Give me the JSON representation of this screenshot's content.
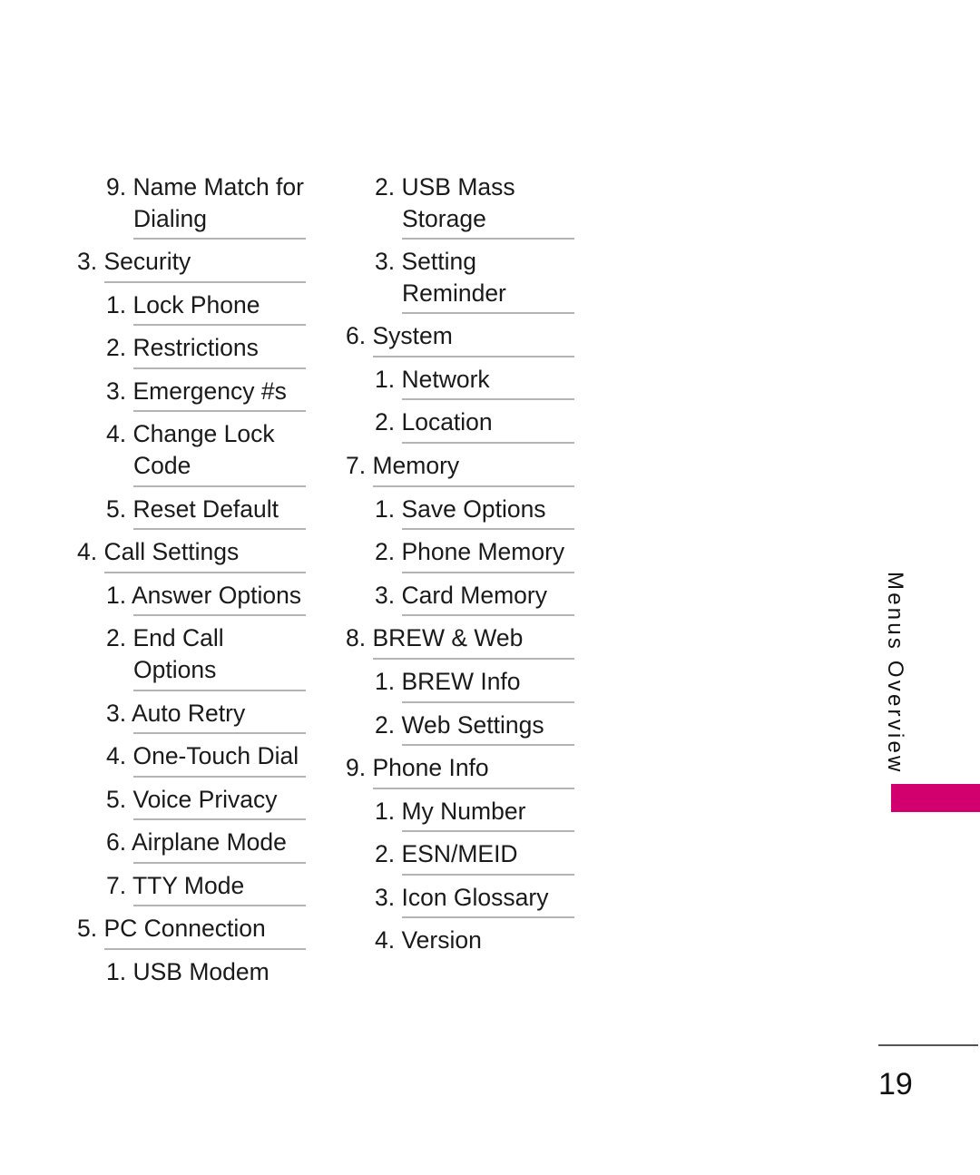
{
  "page": {
    "number": "19",
    "section_label": "Menus Overview",
    "accent_color": "#d2006e",
    "rule_color": "#b4b4b4",
    "text_color": "#1a1a1a"
  },
  "columns": [
    {
      "id": "left",
      "items": [
        {
          "label": "9. Name Match for Dialing",
          "level": 2
        },
        {
          "label": "3. Security",
          "level": 1
        },
        {
          "label": "1. Lock Phone",
          "level": 2
        },
        {
          "label": "2. Restrictions",
          "level": 2
        },
        {
          "label": "3. Emergency #s",
          "level": 2
        },
        {
          "label": "4. Change Lock Code",
          "level": 2
        },
        {
          "label": "5. Reset Default",
          "level": 2
        },
        {
          "label": "4. Call Settings",
          "level": 1
        },
        {
          "label": "1. Answer Options",
          "level": 2
        },
        {
          "label": "2. End Call Options",
          "level": 2
        },
        {
          "label": "3. Auto Retry",
          "level": 2
        },
        {
          "label": "4. One-Touch Dial",
          "level": 2
        },
        {
          "label": "5. Voice Privacy",
          "level": 2
        },
        {
          "label": "6. Airplane Mode",
          "level": 2
        },
        {
          "label": "7. TTY Mode",
          "level": 2
        },
        {
          "label": "5. PC Connection",
          "level": 1
        },
        {
          "label": "1. USB Modem",
          "level": 2,
          "last": true
        }
      ]
    },
    {
      "id": "right",
      "items": [
        {
          "label": "2. USB Mass Storage",
          "level": 2
        },
        {
          "label": "3. Setting Reminder",
          "level": 2
        },
        {
          "label": "6. System",
          "level": 1
        },
        {
          "label": "1. Network",
          "level": 2
        },
        {
          "label": "2. Location",
          "level": 2
        },
        {
          "label": "7. Memory",
          "level": 1
        },
        {
          "label": "1. Save Options",
          "level": 2
        },
        {
          "label": "2. Phone Memory",
          "level": 2
        },
        {
          "label": "3. Card Memory",
          "level": 2
        },
        {
          "label": "8. BREW & Web",
          "level": 1
        },
        {
          "label": "1. BREW Info",
          "level": 2
        },
        {
          "label": "2. Web Settings",
          "level": 2
        },
        {
          "label": "9. Phone Info",
          "level": 1
        },
        {
          "label": "1. My Number",
          "level": 2
        },
        {
          "label": "2. ESN/MEID",
          "level": 2
        },
        {
          "label": "3. Icon Glossary",
          "level": 2
        },
        {
          "label": "4. Version",
          "level": 2,
          "last": true
        }
      ]
    }
  ]
}
